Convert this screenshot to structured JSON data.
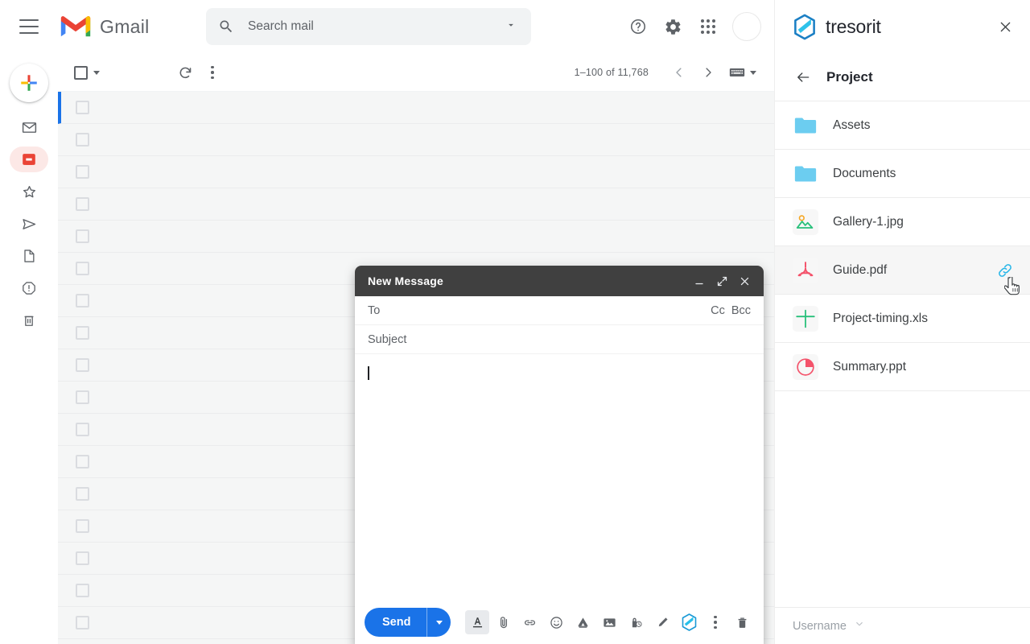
{
  "gmail": {
    "brand": "Gmail",
    "search": {
      "placeholder": "Search mail",
      "value": ""
    },
    "header_icons": {
      "menu": "hamburger-menu-icon",
      "help": "help-icon",
      "settings": "gear-icon",
      "apps": "apps-grid-icon",
      "avatar": "avatar"
    },
    "rail": [
      {
        "name": "compose",
        "icon": "plus-icon",
        "active": false
      },
      {
        "name": "inbox",
        "icon": "envelope-icon",
        "active": false
      },
      {
        "name": "snoozed",
        "icon": "inbox-tray-icon",
        "active": true
      },
      {
        "name": "starred",
        "icon": "star-icon",
        "active": false
      },
      {
        "name": "sent",
        "icon": "send-paper-plane-icon",
        "active": false
      },
      {
        "name": "drafts",
        "icon": "document-icon",
        "active": false
      },
      {
        "name": "spam",
        "icon": "exclamation-octagon-icon",
        "active": false
      },
      {
        "name": "trash",
        "icon": "trash-icon",
        "active": false
      }
    ],
    "toolbar": {
      "select_all": "select-all-checkbox",
      "refresh": "refresh-icon",
      "more": "more-options-icon",
      "page_count": "1–100 of 11,768",
      "prev": "chevron-left-icon",
      "next": "chevron-right-icon",
      "keyboard": "keyboard-icon"
    },
    "list": {
      "row_count": 17
    }
  },
  "compose": {
    "title": "New Message",
    "window_buttons": {
      "minimize": "minimize-icon",
      "expand": "expand-icon",
      "close": "close-icon"
    },
    "to": {
      "label": "To",
      "value": ""
    },
    "cc": "Cc",
    "bcc": "Bcc",
    "subject": {
      "placeholder": "Subject",
      "value": ""
    },
    "body": "",
    "send_label": "Send",
    "send_color": "#1a73e8",
    "toolbar_icons": [
      {
        "name": "formatting-options-icon",
        "selected": true
      },
      {
        "name": "attach-file-icon",
        "selected": false
      },
      {
        "name": "insert-link-icon",
        "selected": false
      },
      {
        "name": "insert-emoji-icon",
        "selected": false
      },
      {
        "name": "insert-drive-icon",
        "selected": false
      },
      {
        "name": "insert-photo-icon",
        "selected": false
      },
      {
        "name": "confidential-mode-icon",
        "selected": false
      },
      {
        "name": "insert-signature-icon",
        "selected": false
      }
    ],
    "tresorit_icon": "tresorit-hexagon-icon",
    "more_icon": "more-options-icon",
    "discard_icon": "trash-icon"
  },
  "panel": {
    "brand": "tresorit",
    "brand_color": "#1b9ad6",
    "close_icon": "close-icon",
    "back_icon": "arrow-left-icon",
    "title": "Project",
    "files": [
      {
        "name": "Assets",
        "icon": "folder-icon",
        "type": "folder",
        "hover": false,
        "action": null
      },
      {
        "name": "Documents",
        "icon": "folder-icon",
        "type": "folder",
        "hover": false,
        "action": null
      },
      {
        "name": "Gallery-1.jpg",
        "icon": "image-file-icon",
        "type": "image",
        "hover": false,
        "action": null
      },
      {
        "name": "Guide.pdf",
        "icon": "pdf-file-icon",
        "type": "pdf",
        "hover": true,
        "action": "link-icon"
      },
      {
        "name": "Project-timing.xls",
        "icon": "spreadsheet-file-icon",
        "type": "xls",
        "hover": false,
        "action": null
      },
      {
        "name": "Summary.ppt",
        "icon": "presentation-file-icon",
        "type": "ppt",
        "hover": false,
        "action": null
      }
    ],
    "footer": {
      "username": "Username",
      "caret": "chevron-down-icon"
    }
  }
}
